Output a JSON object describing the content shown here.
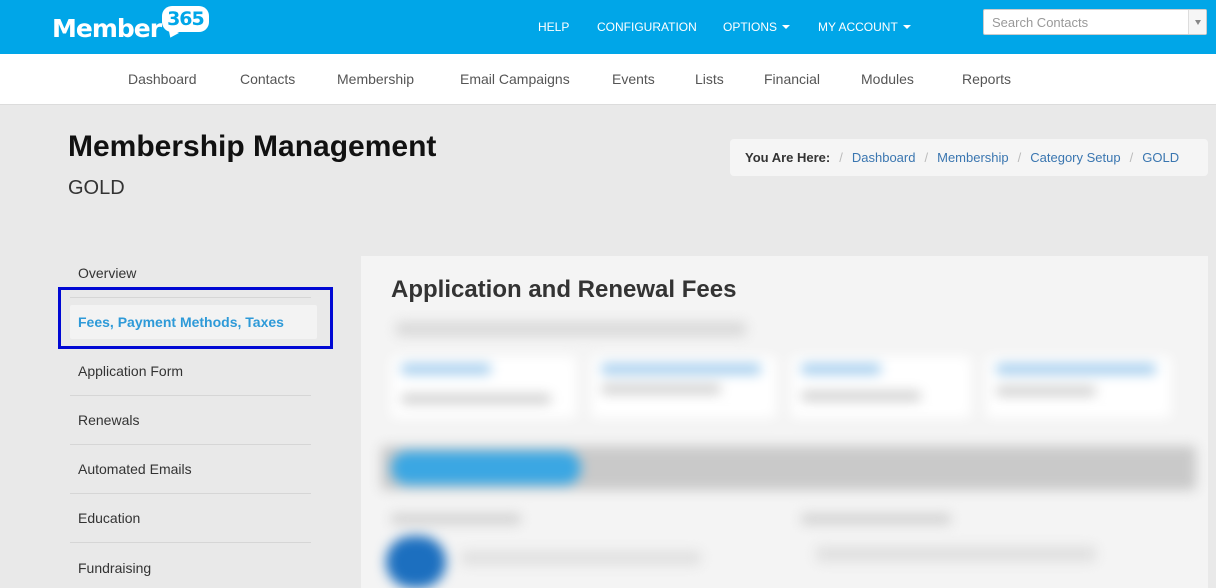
{
  "logo": {
    "text": "Member",
    "badge": "365"
  },
  "topnav": {
    "help": "HELP",
    "configuration": "CONFIGURATION",
    "options": "OPTIONS",
    "my_account": "MY ACCOUNT"
  },
  "search": {
    "placeholder": "Search Contacts"
  },
  "subnav": {
    "dashboard": "Dashboard",
    "contacts": "Contacts",
    "membership": "Membership",
    "email_campaigns": "Email Campaigns",
    "events": "Events",
    "lists": "Lists",
    "financial": "Financial",
    "modules": "Modules",
    "reports": "Reports"
  },
  "page": {
    "title": "Membership Management",
    "subtitle": "GOLD"
  },
  "breadcrumb": {
    "label": "You Are Here:",
    "items": [
      "Dashboard",
      "Membership",
      "Category Setup",
      "GOLD"
    ]
  },
  "sidemenu": {
    "items": [
      "Overview",
      "Fees, Payment Methods, Taxes",
      "Application Form",
      "Renewals",
      "Automated Emails",
      "Education",
      "Fundraising"
    ]
  },
  "panel": {
    "title": "Application and Renewal Fees"
  },
  "colors": {
    "brand": "#00a6e8",
    "link": "#3a76b0",
    "active": "#2e9ad8",
    "highlight": "#0008d4"
  }
}
